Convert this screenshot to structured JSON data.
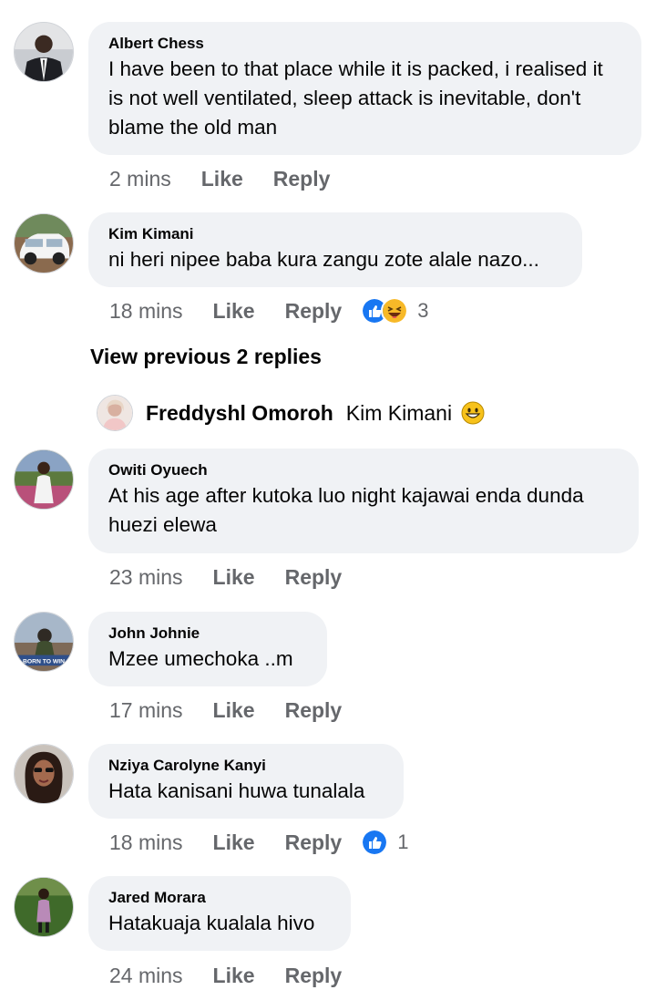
{
  "comments": [
    {
      "author": "Albert Chess",
      "text": "I have been to that place while it is packed, i realised it is not well ventilated, sleep attack is inevitable, don't blame the old man",
      "time": "2 mins",
      "like": "Like",
      "reply": "Reply"
    },
    {
      "author": "Kim Kimani",
      "text": "ni heri nipee baba kura zangu zote alale nazo...",
      "time": "18 mins",
      "like": "Like",
      "reply": "Reply",
      "reaction_count": "3"
    },
    {
      "author": "Owiti Oyuech",
      "text": "At his age after kutoka luo night kajawai enda dunda huezi elewa",
      "time": "23 mins",
      "like": "Like",
      "reply": "Reply"
    },
    {
      "author": "John Johnie",
      "text": "Mzee umechoka ..m",
      "time": "17 mins",
      "like": "Like",
      "reply": "Reply",
      "avatar_text": "BORN TO WIN"
    },
    {
      "author": "Nziya Carolyne Kanyi",
      "text": "Hata kanisani huwa tunalala",
      "time": "18 mins",
      "like": "Like",
      "reply": "Reply",
      "reaction_count": "1"
    },
    {
      "author": "Jared Morara",
      "text": "Hatakuaja kualala hivo",
      "time": "24 mins",
      "like": "Like",
      "reply": "Reply"
    }
  ],
  "view_previous": "View previous 2 replies",
  "reply_preview": {
    "author": "Freddyshl Omoroh",
    "text": "Kim Kimani"
  },
  "colors": {
    "bubble": "#f0f2f5",
    "meta": "#65676b",
    "like_blue": "#1877f2",
    "haha_yellow": "#f7b928"
  }
}
